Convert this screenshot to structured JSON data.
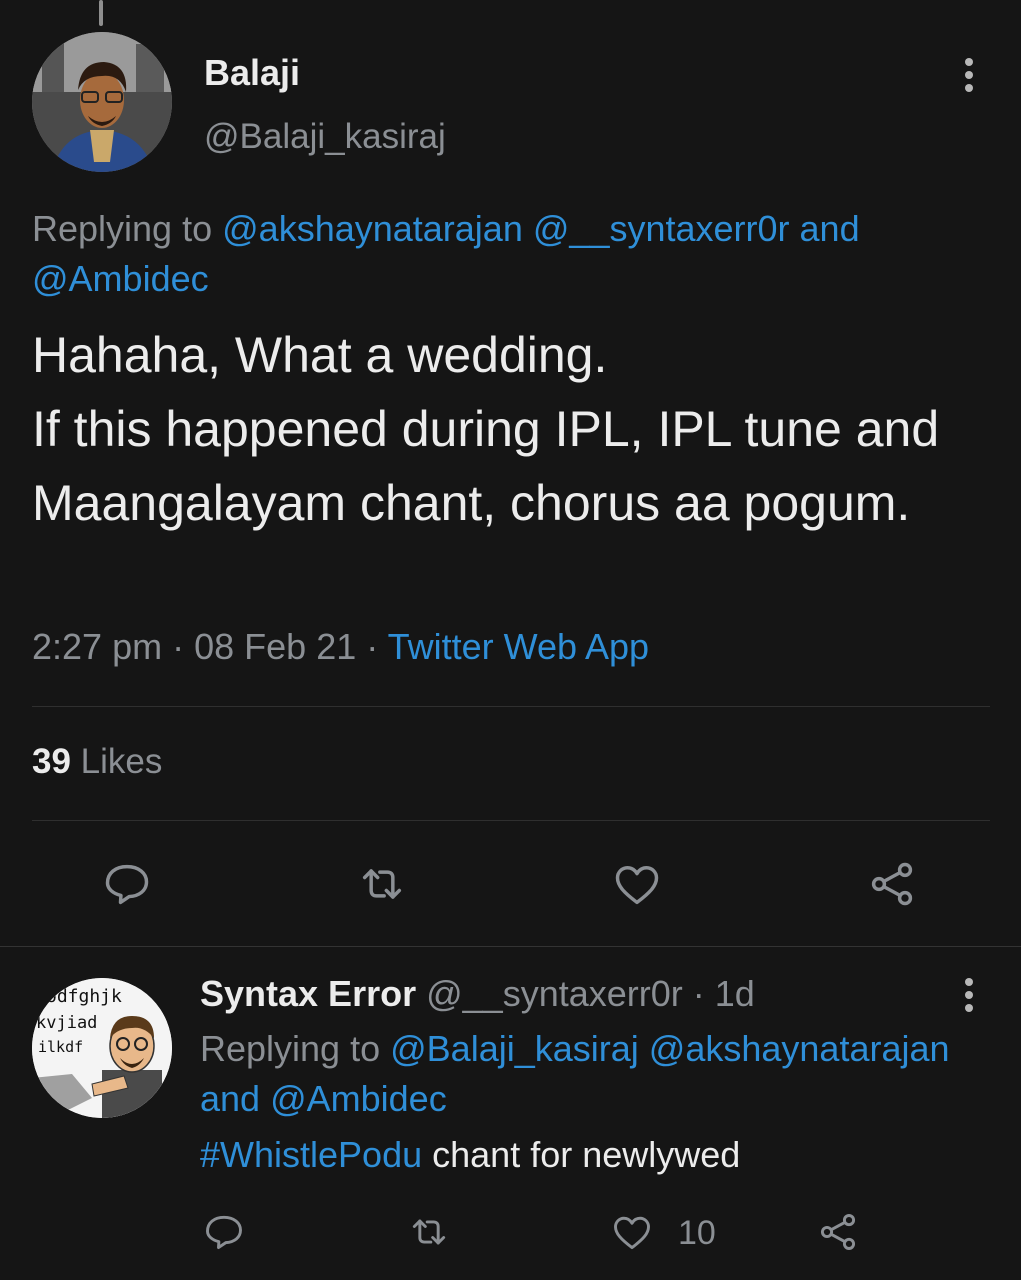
{
  "main_tweet": {
    "name": "Balaji",
    "handle": "@Balaji_kasiraj",
    "replying_prefix": "Replying to",
    "replying_handle_1": "@akshaynatarajan",
    "replying_handle_2": "@__syntaxerr0r",
    "replying_and": "and",
    "replying_handle_3": "@Ambidec",
    "text": "Hahaha, What a wedding.\nIf this happened during IPL, IPL tune and Maangalayam chant, chorus aa pogum.",
    "time": "2:27 pm",
    "sep1": "·",
    "date": "08 Feb 21",
    "sep2": "·",
    "source": "Twitter Web App",
    "likes_count": "39",
    "likes_label": "Likes"
  },
  "reply_tweet": {
    "name": "Syntax Error",
    "handle": "@__syntaxerr0r",
    "sep": "·",
    "age": "1d",
    "replying_prefix": "Replying to",
    "replying_handle_1": "@Balaji_kasiraj",
    "replying_handle_2": "@akshaynatarajan",
    "replying_and": "and",
    "replying_handle_3": "@Ambidec",
    "hashtag": "#WhistlePodu",
    "text": "chant for newlywed",
    "like_count": "10"
  },
  "avatar_scribble_lines": [
    "odfghjk",
    "kvjiad",
    "ilkdf"
  ],
  "colors": {
    "background": "#151515",
    "link": "#2f8fd8",
    "secondary_text": "#8b8f94",
    "primary_text": "#ececec"
  }
}
